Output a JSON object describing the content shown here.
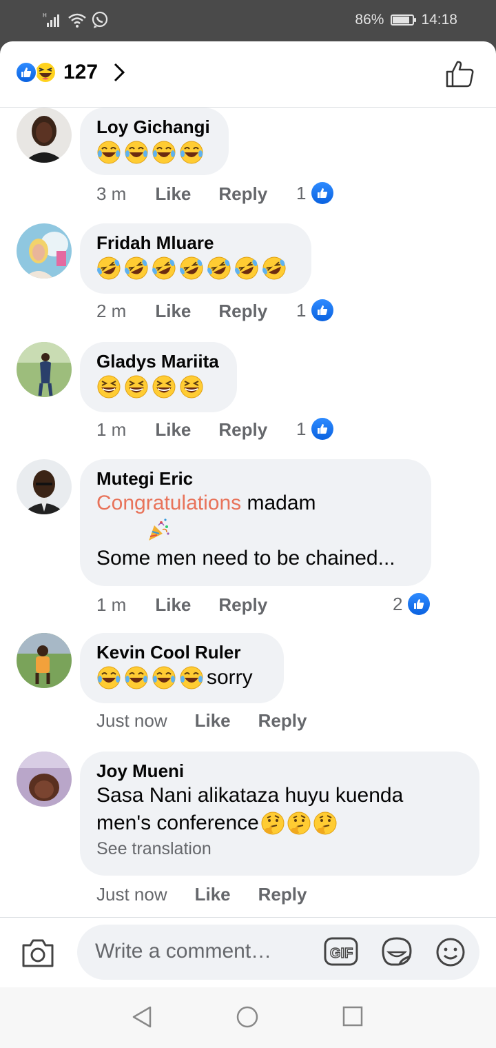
{
  "status_bar": {
    "battery": "86%",
    "battery_level": 0.86,
    "time": "14:18"
  },
  "header": {
    "reaction_count": "127",
    "reaction_icons": [
      "like-reaction-icon",
      "haha-reaction-icon"
    ]
  },
  "comments": [
    {
      "author": "Loy Gichangi",
      "emojis": "😂😂😂😂",
      "time": "3 m",
      "like": "Like",
      "reply": "Reply",
      "likes": "1"
    },
    {
      "author": "Fridah Mluare",
      "emojis": "🤣🤣🤣🤣🤣🤣🤣",
      "time": "2 m",
      "like": "Like",
      "reply": "Reply",
      "likes": "1"
    },
    {
      "author": "Gladys Mariita",
      "emojis": "😆😆😆😆",
      "time": "1 m",
      "like": "Like",
      "reply": "Reply",
      "likes": "1"
    },
    {
      "author": "Mutegi Eric",
      "line1_highlight": "Congratulations",
      "line1_rest": " madam",
      "emoji_line": "🎉",
      "line2": "Some men need to be chained...",
      "time": "1 m",
      "like": "Like",
      "reply": "Reply",
      "likes": "2"
    },
    {
      "author": "Kevin Cool Ruler",
      "emojis": "😂😂😂😂",
      "text": "sorry",
      "time": "Just now",
      "like": "Like",
      "reply": "Reply"
    },
    {
      "author": "Joy Mueni",
      "line1": "Sasa Nani alikataza huyu kuenda",
      "line2": "men's conference",
      "emojis": "🤔🤔🤔",
      "translation": "See translation",
      "time": "Just now",
      "like": "Like",
      "reply": "Reply"
    }
  ],
  "composer": {
    "placeholder": "Write a comment…"
  },
  "colors": {
    "facebook_blue": "#1877f2",
    "bubble": "#f0f2f5",
    "highlight": "#e8735a",
    "meta_gray": "#65676b"
  }
}
